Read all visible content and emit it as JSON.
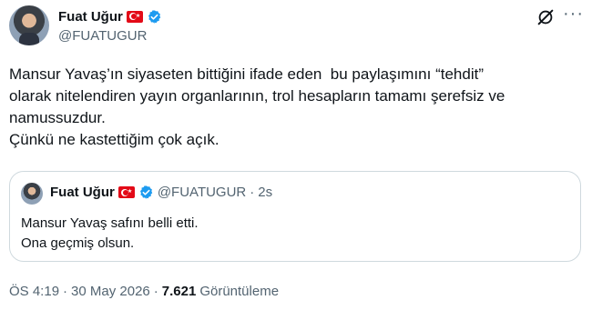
{
  "author": {
    "name": "Fuat Uğur",
    "handle": "@FUATUGUR"
  },
  "tweet": {
    "lines": [
      "Mansur Yavaş’ın siyaseten bittiğini ifade eden  bu paylaşımını “tehdit”",
      "olarak nitelendiren yayın organlarının, trol hesapların tamamı şerefsiz ve",
      "namussuzdur.",
      "Çünkü ne kastettiğim çok açık."
    ]
  },
  "quote": {
    "name": "Fuat Uğur",
    "handle": "@FUATUGUR",
    "separator": "·",
    "time": "2s",
    "lines": [
      "Mansur Yavaş safını belli etti.",
      "Ona geçmiş olsun."
    ]
  },
  "meta": {
    "time": "ÖS 4:19",
    "sep1": "·",
    "date": "30 May 2026",
    "sep2": "·",
    "views_count": "7.621",
    "views_label": "Görüntüleme"
  },
  "colors": {
    "text": "#0f1419",
    "secondary": "#536471",
    "verified": "#1d9bf0",
    "flag": "#e30a17",
    "border": "#cfd9de"
  },
  "icons": [
    "verified-badge-icon",
    "turkey-flag-icon",
    "grok-icon",
    "more-icon"
  ]
}
